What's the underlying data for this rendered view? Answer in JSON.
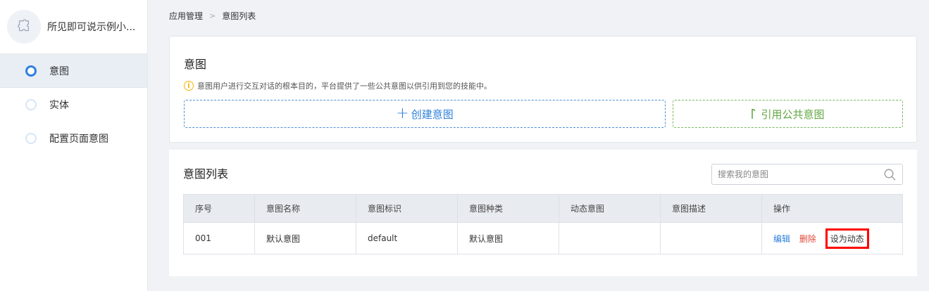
{
  "sidebar": {
    "app_name": "所见即可说示例小...",
    "items": [
      {
        "label": "意图",
        "active": true
      },
      {
        "label": "实体",
        "active": false
      },
      {
        "label": "配置页面意图",
        "active": false
      }
    ]
  },
  "breadcrumb": {
    "parent": "应用管理",
    "separator": ">",
    "current": "意图列表"
  },
  "intent_card": {
    "title": "意图",
    "tip": "意图用户进行交互对话的根本目的，平台提供了一些公共意图以供引用到您的技能中。",
    "create_label": "创建意图",
    "reference_label": "引用公共意图"
  },
  "list_card": {
    "title": "意图列表",
    "search_placeholder": "搜索我的意图",
    "columns": [
      "序号",
      "意图名称",
      "意图标识",
      "意图种类",
      "动态意图",
      "意图描述",
      "操作"
    ],
    "rows": [
      {
        "index": "001",
        "name": "默认意图",
        "identifier": "default",
        "kind": "默认意图",
        "dynamic": "",
        "description": ""
      }
    ],
    "actions": {
      "edit": "编辑",
      "delete": "删除",
      "set_dynamic": "设为动态"
    }
  },
  "colors": {
    "accent": "#2f80d9",
    "green": "#62a843",
    "danger": "#e04a3a",
    "highlight": "#ff0000"
  }
}
